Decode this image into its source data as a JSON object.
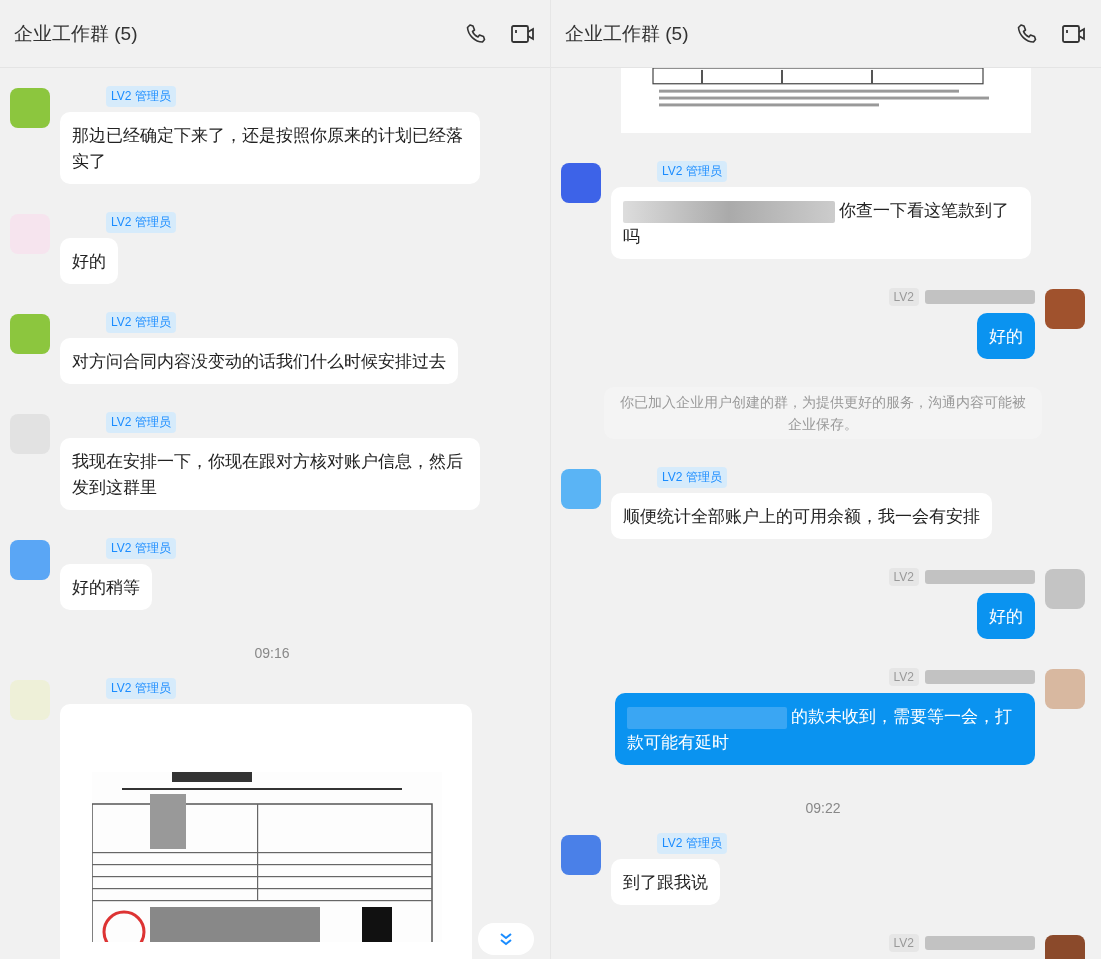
{
  "panels": [
    {
      "title": "企业工作群 (5)",
      "scroll_down_button": true,
      "messages": [
        {
          "kind": "incoming",
          "color": "#8cc63e",
          "badge": "LV2 管理员",
          "text": "那边已经确定下来了，还是按照你原来的计划已经落实了"
        },
        {
          "kind": "incoming",
          "color": "#f6e4ee",
          "badge": "LV2 管理员",
          "text": "好的"
        },
        {
          "kind": "incoming",
          "color": "#8cc63e",
          "badge": "LV2 管理员",
          "text": "对方问合同内容没变动的话我们什么时候安排过去"
        },
        {
          "kind": "incoming",
          "color": "#e2e2e2",
          "badge": "LV2 管理员",
          "text": "我现在安排一下，你现在跟对方核对账户信息，然后发到这群里"
        },
        {
          "kind": "incoming",
          "color": "#5aa6f5",
          "badge": "LV2 管理员",
          "text": "好的稍等"
        },
        {
          "kind": "time",
          "text": "09:16"
        },
        {
          "color": "#eef0d8",
          "badge": "LV2 管理员"
        }
      ]
    },
    {
      "title": "企业工作群 (5)",
      "messages": [
        {
          "kind": "image-tail"
        },
        {
          "kind": "incoming",
          "color": "#3d63e8",
          "badge": "LV2 管理员",
          "redacted": true,
          "text": "你查一下看这笔款到了吗"
        },
        {
          "kind": "outgoing",
          "color": "#a0522d",
          "badge": "LV2",
          "text": "好的"
        },
        {
          "kind": "system",
          "text": "你已加入企业用户创建的群，为提供更好的服务，沟通内容可能被企业保存。"
        },
        {
          "kind": "incoming",
          "color": "#5ab4f5",
          "badge": "LV2 管理员",
          "text": "顺便统计全部账户上的可用余额，我一会有安排"
        },
        {
          "kind": "outgoing",
          "color": "#c4c4c4",
          "badge": "LV2",
          "text": "好的"
        },
        {
          "kind": "outgoing",
          "color": "#d8b8a0",
          "badge": "LV2",
          "redacted": true,
          "text": "的款未收到，需要等一会，打款可能有延时"
        },
        {
          "kind": "time",
          "text": "09:22"
        },
        {
          "kind": "incoming",
          "color": "#4a80e8",
          "badge": "LV2 管理员",
          "text": "到了跟我说"
        },
        {
          "kind": "outgoing",
          "color": "#8b4a2b",
          "badge": "LV2"
        }
      ]
    }
  ]
}
